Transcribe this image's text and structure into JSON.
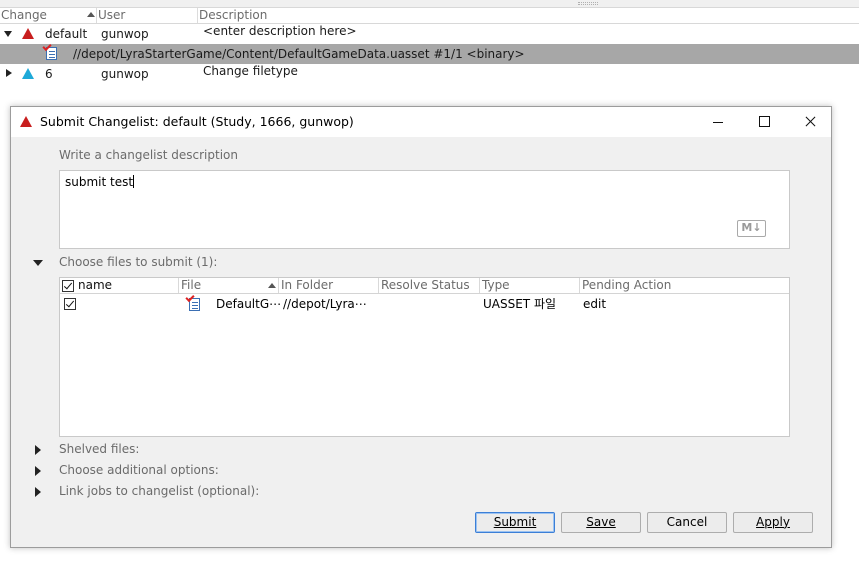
{
  "list": {
    "headers": {
      "change": "Change",
      "user": "User",
      "description": "Description"
    },
    "rows": [
      {
        "change": "default",
        "user": "gunwop",
        "description": "<enter description here>",
        "status_color": "#c81e1e"
      },
      {
        "file": "//depot/LyraStarterGame/Content/DefaultGameData.uasset #1/1 <binary>"
      },
      {
        "change": "6",
        "user": "gunwop",
        "description": "Change filetype",
        "status_color": "#1ea9d8"
      }
    ]
  },
  "dialog": {
    "title": "Submit Changelist: default (Study,  1666,  gunwop)",
    "description_label": "Write a changelist description",
    "description_value": "submit test",
    "markdown_badge": "M↓",
    "files_section_label": "Choose files to submit (1):",
    "files_table": {
      "headers": [
        "name",
        "File",
        "In Folder",
        "Resolve Status",
        "Type",
        "Pending Action"
      ],
      "rows": [
        {
          "checked": true,
          "file": "DefaultG⋯",
          "folder": "//depot/Lyra⋯",
          "resolve_status": "",
          "type": "UASSET 파일",
          "pending_action": "edit"
        }
      ]
    },
    "shelved_label": "Shelved files:",
    "options_label": "Choose additional options:",
    "jobs_label": "Link jobs to changelist (optional):",
    "buttons": {
      "submit": "Submit",
      "save": "Save",
      "cancel": "Cancel",
      "apply": "Apply"
    }
  },
  "colors": {
    "selected_row": "#a7a7a7",
    "dialog_body": "#f0f0f0",
    "default_button_border": "#3c7fd6"
  }
}
